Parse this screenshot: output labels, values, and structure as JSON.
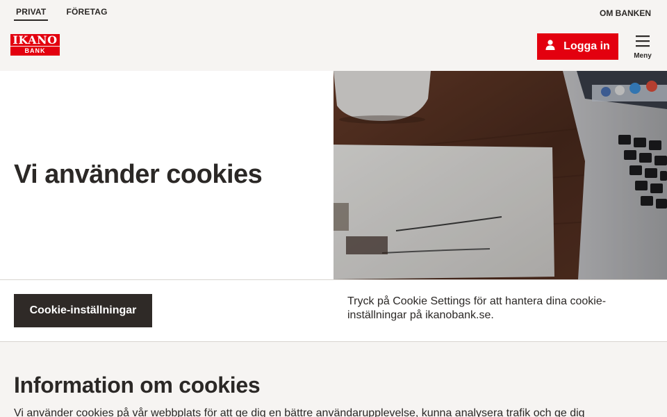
{
  "header": {
    "nav": [
      "PRIVAT",
      "FÖRETAG"
    ],
    "om_banken": "OM BANKEN",
    "logo_top": "IKANO",
    "logo_bottom": "BANK",
    "login_label": "Logga in",
    "menu_label": "Meny"
  },
  "hero": {
    "title": "Vi använder cookies"
  },
  "cookie_bar": {
    "button_label": "Cookie-inställningar",
    "text": "Tryck på Cookie Settings för att hantera dina cookie-inställningar på ikanobank.se."
  },
  "info": {
    "title": "Information om cookies",
    "text": "Vi använder cookies på vår webbplats för att ge dig en bättre användarupplevelse, kunna analysera trafik och ge dig"
  },
  "colors": {
    "brand_red": "#e3000f",
    "dark": "#2f2a27",
    "background": "#f6f4f2"
  },
  "icons": [
    "user-icon",
    "hamburger-menu-icon"
  ]
}
